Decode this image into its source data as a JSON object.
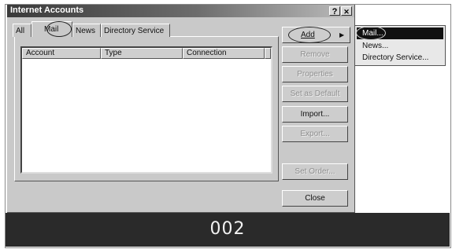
{
  "window": {
    "title": "Internet Accounts",
    "help_btn": "?",
    "close_btn": "✕"
  },
  "tabs": [
    {
      "label": "All"
    },
    {
      "label": "Mail"
    },
    {
      "label": "News"
    },
    {
      "label": "Directory Service"
    }
  ],
  "columns": [
    "Account",
    "Type",
    "Connection"
  ],
  "buttons": {
    "add": "Add",
    "remove": "Remove",
    "properties": "Properties",
    "set_default": "Set as Default",
    "import": "Import...",
    "export": "Export...",
    "set_order": "Set Order...",
    "close": "Close"
  },
  "add_menu": {
    "items": [
      {
        "label": "Mail..."
      },
      {
        "label": "News..."
      },
      {
        "label": "Directory Service..."
      }
    ]
  },
  "caption": "002"
}
